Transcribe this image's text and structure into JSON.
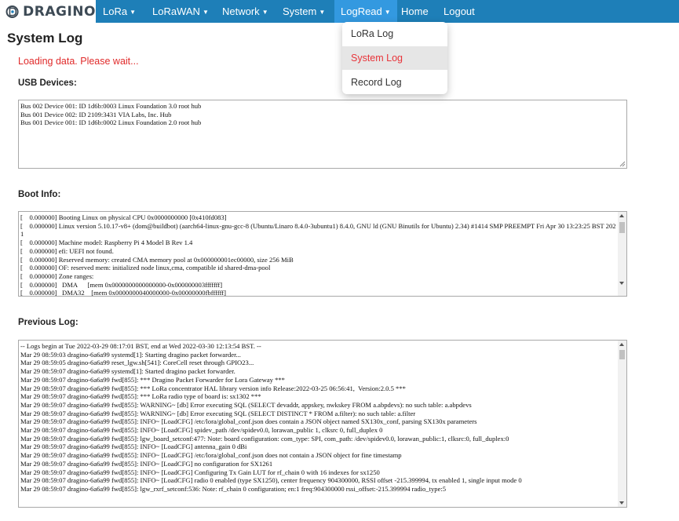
{
  "brand": {
    "logo_text": "DRAGINO",
    "logo_color": "#3d4a55",
    "accent": "#1e7fb8",
    "active_tab_color": "#3399e0"
  },
  "nav": {
    "lora": "LoRa",
    "lorawan": "LoRaWAN",
    "network": "Network",
    "system": "System",
    "logread": "LogRead",
    "home": "Home",
    "logout": "Logout",
    "caret": "▼"
  },
  "dropdown": {
    "lora_log": "LoRa Log",
    "system_log": "System Log",
    "record_log": "Record Log",
    "selected_color": "#e8343a"
  },
  "page": {
    "title": "System Log",
    "loading": "Loading data. Please wait...",
    "loading_color": "#e02a2a"
  },
  "usb": {
    "label": "USB Devices:",
    "text": "Bus 002 Device 001: ID 1d6b:0003 Linux Foundation 3.0 root hub\nBus 001 Device 002: ID 2109:3431 VIA Labs, Inc. Hub\nBus 001 Device 001: ID 1d6b:0002 Linux Foundation 2.0 root hub"
  },
  "boot": {
    "label": "Boot Info:",
    "text": "[    0.000000] Booting Linux on physical CPU 0x0000000000 [0x410fd083]\n[    0.000000] Linux version 5.10.17-v8+ (dom@buildbot) (aarch64-linux-gnu-gcc-8 (Ubuntu/Linaro 8.4.0-3ubuntu1) 8.4.0, GNU ld (GNU Binutils for Ubuntu) 2.34) #1414 SMP PREEMPT Fri Apr 30 13:23:25 BST 2021\n[    0.000000] Machine model: Raspberry Pi 4 Model B Rev 1.4\n[    0.000000] efi: UEFI not found.\n[    0.000000] Reserved memory: created CMA memory pool at 0x000000001ec00000, size 256 MiB\n[    0.000000] OF: reserved mem: initialized node linux,cma, compatible id shared-dma-pool\n[    0.000000] Zone ranges:\n[    0.000000]   DMA      [mem 0x0000000000000000-0x000000003fffffff]\n[    0.000000]   DMA32    [mem 0x0000000040000000-0x00000000fbffffff]"
  },
  "previous": {
    "label": "Previous Log:",
    "text": "-- Logs begin at Tue 2022-03-29 08:17:01 BST, end at Wed 2022-03-30 12:13:54 BST. --\nMar 29 08:59:03 dragino-6a6a99 systemd[1]: Starting dragino packet forwarder...\nMar 29 08:59:05 dragino-6a6a99 reset_lgw.sh[541]: CoreCell reset through GPIO23...\nMar 29 08:59:07 dragino-6a6a99 systemd[1]: Started dragino packet forwarder.\nMar 29 08:59:07 dragino-6a6a99 fwd[855]: *** Dragino Packet Forwarder for Lora Gateway ***\nMar 29 08:59:07 dragino-6a6a99 fwd[855]: *** LoRa concentrator HAL library version info Release:2022-03-25 06:56:41,  Version:2.0.5 ***\nMar 29 08:59:07 dragino-6a6a99 fwd[855]: *** LoRa radio type of board is: sx1302 ***\nMar 29 08:59:07 dragino-6a6a99 fwd[855]: WARNING~ [db] Error executing SQL (SELECT devaddr, appskey, nwkskey FROM a.abpdevs): no such table: a.abpdevs\nMar 29 08:59:07 dragino-6a6a99 fwd[855]: WARNING~ [db] Error executing SQL (SELECT DISTINCT * FROM a.filter): no such table: a.filter\nMar 29 08:59:07 dragino-6a6a99 fwd[855]: INFO~ [LoadCFG] /etc/lora/global_conf.json does contain a JSON object named SX130x_conf, parsing SX130x parameters\nMar 29 08:59:07 dragino-6a6a99 fwd[855]: INFO~ [LoadCFG] spidev_path /dev/spidev0.0, lorawan_public 1, clksrc 0, full_duplex 0\nMar 29 08:59:07 dragino-6a6a99 fwd[855]: lgw_board_setconf:477: Note: board configuration: com_type: SPI, com_path: /dev/spidev0.0, lorawan_public:1, clksrc:0, full_duplex:0\nMar 29 08:59:07 dragino-6a6a99 fwd[855]: INFO~ [LoadCFG] antenna_gain 0 dBi\nMar 29 08:59:07 dragino-6a6a99 fwd[855]: INFO~ [LoadCFG] /etc/lora/global_conf.json does not contain a JSON object for fine timestamp\nMar 29 08:59:07 dragino-6a6a99 fwd[855]: INFO~ [LoadCFG] no configuration for SX1261\nMar 29 08:59:07 dragino-6a6a99 fwd[855]: INFO~ [LoadCFG] Configuring Tx Gain LUT for rf_chain 0 with 16 indexes for sx1250\nMar 29 08:59:07 dragino-6a6a99 fwd[855]: INFO~ [LoadCFG] radio 0 enabled (type SX1250), center frequency 904300000, RSSI offset -215.399994, tx enabled 1, single input mode 0\nMar 29 08:59:07 dragino-6a6a99 fwd[855]: lgw_rxrf_setconf:536: Note: rf_chain 0 configuration; en:1 freq:904300000 rssi_offset:-215.399994 radio_type:5"
  }
}
